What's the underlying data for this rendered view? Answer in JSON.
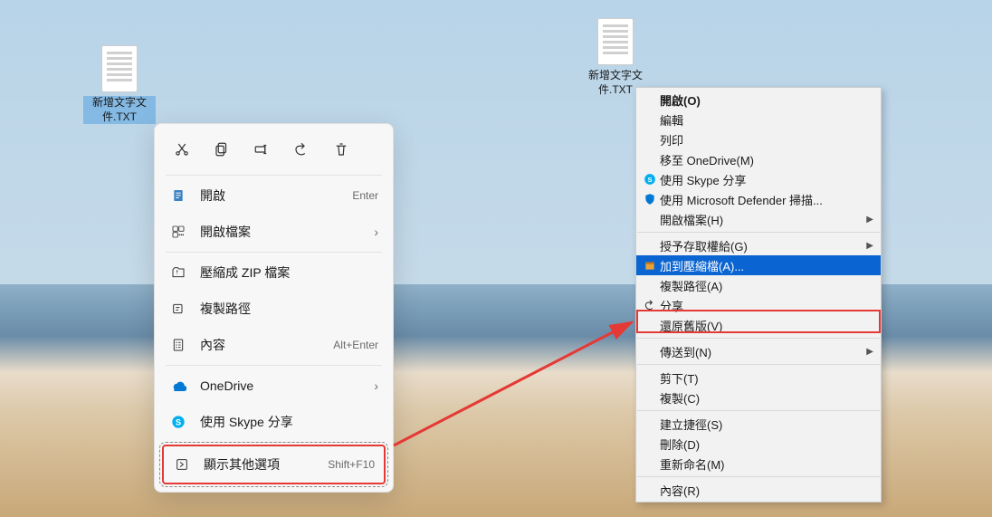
{
  "file": {
    "name": "新增文字文件.TXT"
  },
  "ctx11": {
    "toolbar": [
      "cut",
      "copy",
      "rename",
      "share",
      "delete"
    ],
    "items": [
      {
        "icon": "doc-icon",
        "label": "開啟",
        "accel": "Enter"
      },
      {
        "icon": "open-with-icon",
        "label": "開啟檔案",
        "sub": true
      },
      {
        "sep": true
      },
      {
        "icon": "zip-icon",
        "label": "壓縮成 ZIP 檔案"
      },
      {
        "icon": "copy-path-icon",
        "label": "複製路徑"
      },
      {
        "icon": "properties-icon",
        "label": "內容",
        "accel": "Alt+Enter"
      },
      {
        "sep": true
      },
      {
        "icon": "onedrive-icon",
        "label": "OneDrive",
        "sub": true
      },
      {
        "icon": "skype-icon",
        "label": "使用 Skype 分享"
      },
      {
        "sep": true
      },
      {
        "icon": "more-icon",
        "label": "顯示其他選項",
        "accel": "Shift+F10",
        "highlight": true
      }
    ]
  },
  "ctxc": {
    "items": [
      {
        "label": "開啟(O)",
        "bold": true
      },
      {
        "label": "編輯"
      },
      {
        "label": "列印"
      },
      {
        "label": "移至 OneDrive(M)"
      },
      {
        "icon": "skype",
        "label": "使用 Skype 分享"
      },
      {
        "icon": "defender",
        "label": "使用 Microsoft Defender 掃描..."
      },
      {
        "label": "開啟檔案(H)",
        "sub": true
      },
      {
        "sep": true
      },
      {
        "label": "授予存取權給(G)",
        "sub": true
      },
      {
        "icon": "archive",
        "label": "加到壓縮檔(A)...",
        "blue": true
      },
      {
        "label": "複製路徑(A)"
      },
      {
        "icon": "share",
        "label": "分享"
      },
      {
        "label": "還原舊版(V)",
        "highlight": true
      },
      {
        "sep": true
      },
      {
        "label": "傳送到(N)",
        "sub": true
      },
      {
        "sep": true
      },
      {
        "label": "剪下(T)"
      },
      {
        "label": "複製(C)"
      },
      {
        "sep": true
      },
      {
        "label": "建立捷徑(S)"
      },
      {
        "label": "刪除(D)"
      },
      {
        "label": "重新命名(M)"
      },
      {
        "sep": true
      },
      {
        "label": "內容(R)"
      }
    ]
  }
}
